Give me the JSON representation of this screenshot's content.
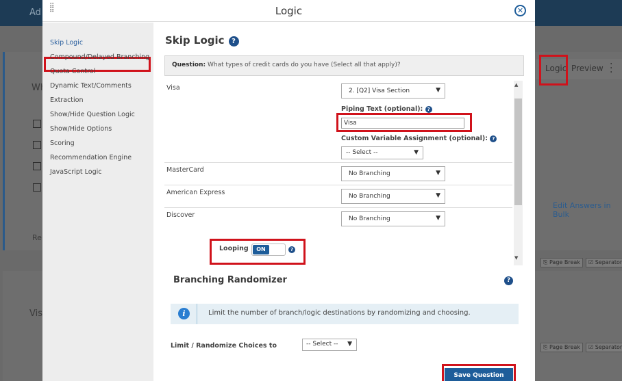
{
  "background": {
    "app_title": "Ad",
    "question_prefix": "Wh",
    "footer_text": "Re",
    "second_question_prefix": "Vis",
    "tabs": {
      "logic": "Logic",
      "preview": "Preview"
    },
    "edit_answers_link": "Edit Answers in Bulk",
    "page_break_label": "Page Break",
    "separator_label": "Separator"
  },
  "modal": {
    "title": "Logic",
    "close_icon": "close-icon"
  },
  "sidebar": {
    "items": [
      {
        "label": "Skip Logic",
        "active": true
      },
      {
        "label": "Compound/Delayed Branching"
      },
      {
        "label": "Quota Control"
      },
      {
        "label": "Dynamic Text/Comments"
      },
      {
        "label": "Extraction"
      },
      {
        "label": "Show/Hide Question Logic"
      },
      {
        "label": "Show/Hide Options"
      },
      {
        "label": "Scoring"
      },
      {
        "label": "Recommendation Engine"
      },
      {
        "label": "JavaScript Logic"
      }
    ]
  },
  "skip_logic": {
    "title": "Skip Logic",
    "question_label": "Question:",
    "question_text": "What types of credit cards do you have (Select all that apply)?",
    "answers": [
      {
        "label": "Visa",
        "branch": "2. [Q2] Visa Section",
        "piping_label": "Piping Text (optional):",
        "piping_value": "Visa",
        "custom_var_label": "Custom Variable Assignment (optional):",
        "custom_var_value": "-- Select --"
      },
      {
        "label": "MasterCard",
        "branch": "No Branching"
      },
      {
        "label": "American Express",
        "branch": "No Branching"
      },
      {
        "label": "Discover",
        "branch": "No Branching"
      }
    ],
    "looping_label": "Looping",
    "looping_state": "ON"
  },
  "randomizer": {
    "title": "Branching Randomizer",
    "info_text": "Limit the number of branch/logic destinations by randomizing and choosing.",
    "limit_label": "Limit / Randomize Choices to",
    "limit_value": "-- Select --"
  },
  "save_button_label": "Save Question Logic"
}
